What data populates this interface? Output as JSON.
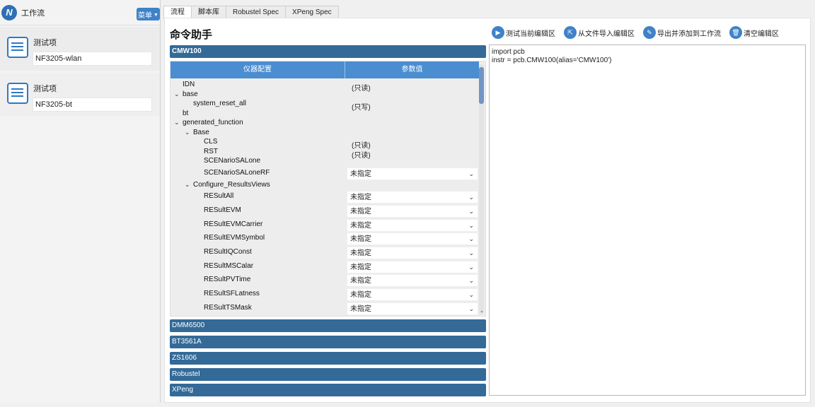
{
  "sidebar": {
    "title": "工作流",
    "menu_label": "菜单",
    "items": [
      {
        "label": "测试项",
        "value": "NF3205-wlan"
      },
      {
        "label": "测试项",
        "value": "NF3205-bt"
      }
    ]
  },
  "tabs": [
    {
      "label": "流程"
    },
    {
      "label": "脚本库"
    },
    {
      "label": "Robustel Spec"
    },
    {
      "label": "XPeng Spec"
    }
  ],
  "content": {
    "title": "命令助手",
    "toolbar": [
      {
        "label": "测试当前编辑区",
        "icon": "play-icon"
      },
      {
        "label": "从文件导入编辑区",
        "icon": "import-icon"
      },
      {
        "label": "导出并添加到工作流",
        "icon": "export-icon"
      },
      {
        "label": "清空编辑区",
        "icon": "trash-icon"
      }
    ],
    "instruments": [
      "CMW100",
      "DMM6500",
      "BT3561A",
      "ZS1606",
      "Robustel",
      "XPeng"
    ],
    "tree": {
      "col_name": "仪器配置",
      "col_value": "参数值",
      "rows": [
        {
          "label": "IDN",
          "value": "(只读)"
        },
        {
          "label": "base"
        },
        {
          "label": "system_reset_all",
          "value": "(只写)"
        },
        {
          "label": "bt"
        },
        {
          "label": "generated_function"
        },
        {
          "label": "Base"
        },
        {
          "label": "CLS",
          "value": "(只读)"
        },
        {
          "label": "RST",
          "value": "(只读)"
        },
        {
          "label": "SCENarioSALone"
        },
        {
          "label": "SCENarioSALoneRF",
          "value": "未指定"
        },
        {
          "label": "Configure_ResultsViews"
        },
        {
          "label": "RESultAll",
          "value": "未指定"
        },
        {
          "label": "RESultEVM",
          "value": "未指定"
        },
        {
          "label": "RESultEVMCarrier",
          "value": "未指定"
        },
        {
          "label": "RESultEVMSymbol",
          "value": "未指定"
        },
        {
          "label": "RESultIQConst",
          "value": "未指定"
        },
        {
          "label": "RESultMSCalar",
          "value": "未指定"
        },
        {
          "label": "RESultPVTime",
          "value": "未指定"
        },
        {
          "label": "RESultSFLatness",
          "value": "未指定"
        },
        {
          "label": "RESultTSMask",
          "value": "未指定"
        }
      ]
    },
    "editor_lines": [
      "import pcb",
      "instr = pcb.CMW100(alias='CMW100')"
    ]
  },
  "colors": {
    "accent": "#3f82c8",
    "group_bar": "#336a98",
    "tree_header": "#4a8dd0"
  }
}
